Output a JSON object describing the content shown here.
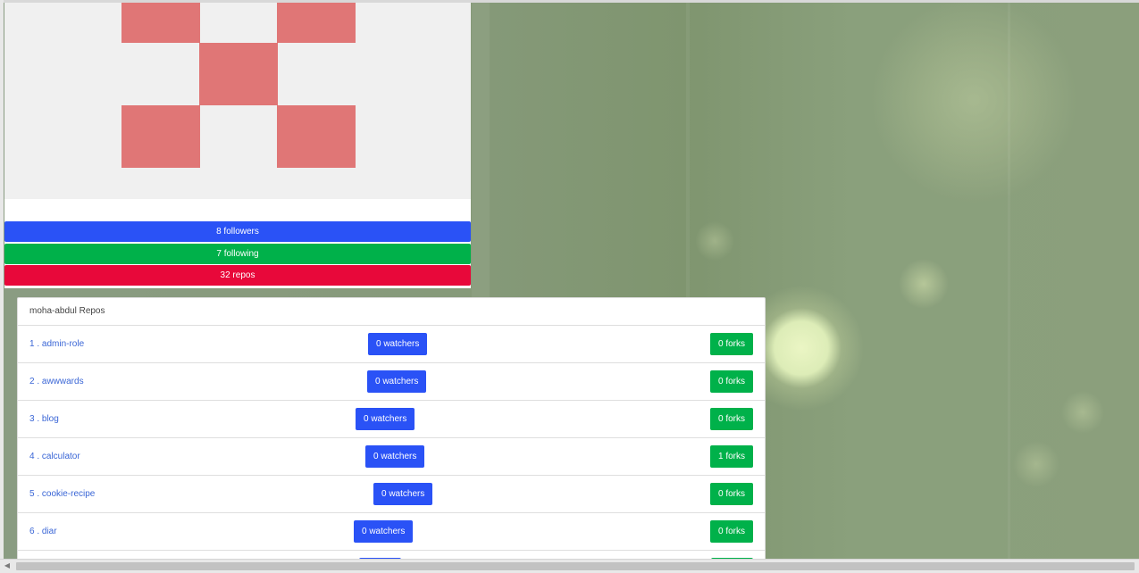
{
  "profile": {
    "followers_label": "8 followers",
    "following_label": "7 following",
    "repos_label": "32 repos"
  },
  "repos": {
    "header": "moha-abdul Repos",
    "items": [
      {
        "name": "1 . admin-role",
        "watchers": "0 watchers",
        "forks": "0 forks"
      },
      {
        "name": "2 . awwwards",
        "watchers": "0 watchers",
        "forks": "0 forks"
      },
      {
        "name": "3 . blog",
        "watchers": "0 watchers",
        "forks": "0 forks"
      },
      {
        "name": "4 . calculator",
        "watchers": "0 watchers",
        "forks": "1 forks"
      },
      {
        "name": "5 . cookie-recipe",
        "watchers": "0 watchers",
        "forks": "0 forks"
      },
      {
        "name": "6 . diar",
        "watchers": "0 watchers",
        "forks": "0 forks"
      },
      {
        "name": "",
        "watchers": "",
        "forks": ""
      }
    ]
  },
  "colors": {
    "followers": "#2a52f6",
    "following": "#00b14a",
    "repos": "#e8083a",
    "identicon": "#e07676"
  },
  "icons": {
    "scroll_left": "triangle-left"
  }
}
